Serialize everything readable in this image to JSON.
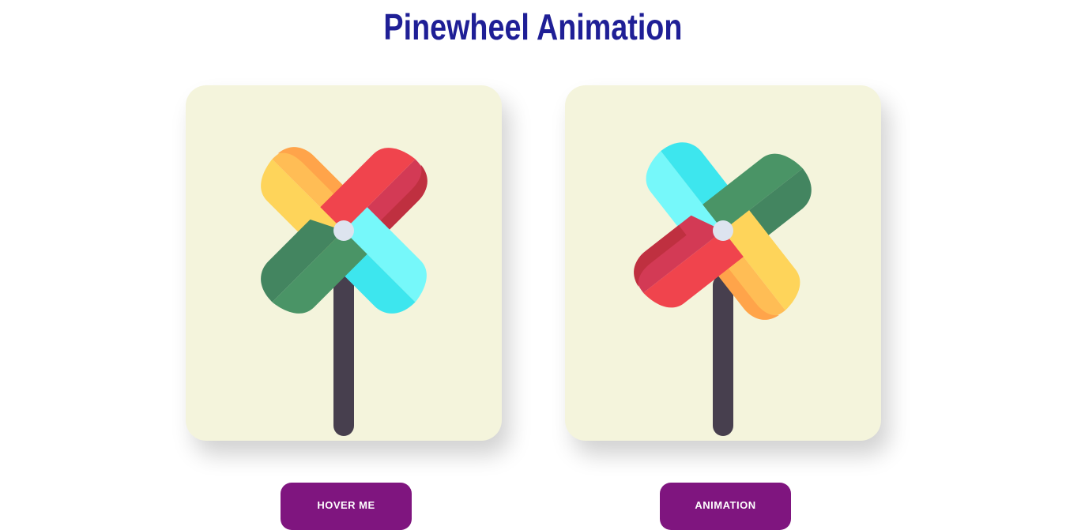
{
  "page": {
    "title": "Pinewheel Animation",
    "title_color": "#1f1f96"
  },
  "cards": [
    {
      "name": "hover-card",
      "background": "#f4f4dc"
    },
    {
      "name": "animation-card",
      "background": "#f4f4dc"
    }
  ],
  "buttons": {
    "hover_label": "HOVER ME",
    "animation_label": "ANIMATION",
    "color": "#7f157f"
  },
  "icons": {
    "pinwheel": "pinwheel-icon"
  },
  "colors": {
    "green": "#4a9466",
    "yellow": "#fed45a",
    "orange": "#ffa44a",
    "red": "#f0444d",
    "cyan": "#3de6ee",
    "stick": "#473f4e",
    "hub": "#dde4ef"
  }
}
